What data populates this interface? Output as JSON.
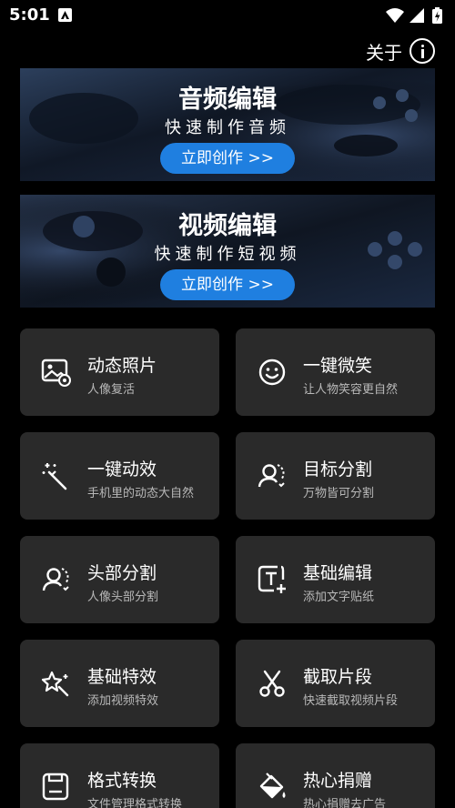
{
  "status_bar": {
    "time": "5:01"
  },
  "header": {
    "about_label": "关于"
  },
  "banners": [
    {
      "title": "音频编辑",
      "subtitle": "快速制作音频",
      "button": "立即创作 >>"
    },
    {
      "title": "视频编辑",
      "subtitle": "快速制作短视频",
      "button": "立即创作 >>"
    }
  ],
  "features": [
    {
      "title": "动态照片",
      "subtitle": "人像复活",
      "icon": "photo-gear-icon"
    },
    {
      "title": "一键微笑",
      "subtitle": "让人物笑容更自然",
      "icon": "smile-icon"
    },
    {
      "title": "一键动效",
      "subtitle": "手机里的动态大自然",
      "icon": "magic-wand-icon"
    },
    {
      "title": "目标分割",
      "subtitle": "万物皆可分割",
      "icon": "person-segment-icon"
    },
    {
      "title": "头部分割",
      "subtitle": "人像头部分割",
      "icon": "head-segment-icon"
    },
    {
      "title": "基础编辑",
      "subtitle": "添加文字贴纸",
      "icon": "text-add-icon"
    },
    {
      "title": "基础特效",
      "subtitle": "添加视频特效",
      "icon": "sparkle-icon"
    },
    {
      "title": "截取片段",
      "subtitle": "快速截取视频片段",
      "icon": "scissors-icon"
    },
    {
      "title": "格式转换",
      "subtitle": "文件管理格式转换",
      "icon": "save-disk-icon"
    },
    {
      "title": "热心捐赠",
      "subtitle": "热心捐赠去广告",
      "icon": "paint-bucket-icon"
    }
  ]
}
